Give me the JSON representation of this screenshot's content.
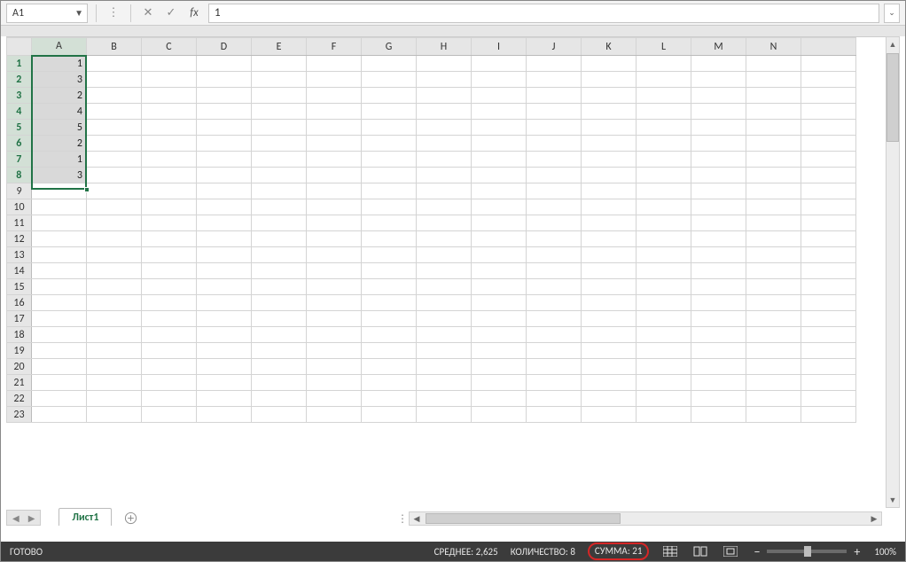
{
  "formula_bar": {
    "name_box": "A1",
    "formula_value": "1"
  },
  "chart_data": {
    "type": "table",
    "columns": [
      "A",
      "B",
      "C",
      "D",
      "E",
      "F",
      "G",
      "H",
      "I",
      "J",
      "K",
      "L",
      "M",
      "N"
    ],
    "row_numbers": [
      1,
      2,
      3,
      4,
      5,
      6,
      7,
      8,
      9,
      10,
      11,
      12,
      13,
      14,
      15,
      16,
      17,
      18,
      19,
      20,
      21,
      22,
      23
    ],
    "data": {
      "A": [
        1,
        3,
        2,
        4,
        5,
        2,
        1,
        3
      ]
    },
    "selection": {
      "col": "A",
      "rows_from": 1,
      "rows_to": 8
    }
  },
  "sheet_tabs": {
    "active": "Лист1"
  },
  "status_bar": {
    "ready": "ГОТОВО",
    "average_label": "СРЕДНЕЕ:",
    "average_value": "2,625",
    "count_label": "КОЛИЧЕСТВО:",
    "count_value": "8",
    "sum_label": "СУММА:",
    "sum_value": "21",
    "zoom": "100%"
  }
}
